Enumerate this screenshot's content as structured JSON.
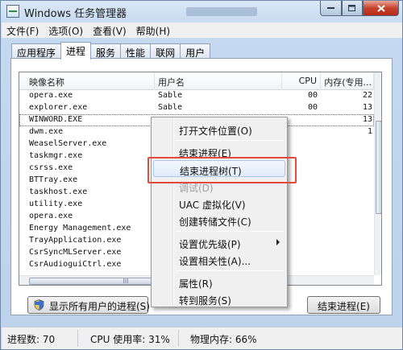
{
  "window": {
    "title": "Windows 任务管理器"
  },
  "menu": [
    "文件(F)",
    "选项(O)",
    "查看(V)",
    "帮助(H)"
  ],
  "tabs": [
    {
      "label": "应用程序",
      "active": false
    },
    {
      "label": "进程",
      "active": true
    },
    {
      "label": "服务",
      "active": false
    },
    {
      "label": "性能",
      "active": false
    },
    {
      "label": "联网",
      "active": false
    },
    {
      "label": "用户",
      "active": false
    }
  ],
  "process_list": {
    "columns": [
      "映像名称",
      "用户名",
      "CPU",
      "内存(专用..."
    ],
    "rows": [
      {
        "name": "opera.exe",
        "user": "Sable",
        "cpu": "00",
        "mem": "22"
      },
      {
        "name": "explorer.exe",
        "user": "Sable",
        "cpu": "00",
        "mem": "13"
      },
      {
        "name": "WINWORD.EXE",
        "user": "",
        "cpu": "",
        "mem": "13"
      },
      {
        "name": "dwm.exe",
        "user": "",
        "cpu": "",
        "mem": "1"
      },
      {
        "name": "WeaselServer.exe",
        "user": "",
        "cpu": "",
        "mem": ""
      },
      {
        "name": "taskmgr.exe",
        "user": "",
        "cpu": "",
        "mem": ""
      },
      {
        "name": "csrss.exe",
        "user": "",
        "cpu": "",
        "mem": ""
      },
      {
        "name": "BTTray.exe",
        "user": "",
        "cpu": "",
        "mem": ""
      },
      {
        "name": "taskhost.exe",
        "user": "",
        "cpu": "",
        "mem": ""
      },
      {
        "name": "utility.exe",
        "user": "",
        "cpu": "",
        "mem": ""
      },
      {
        "name": "opera.exe",
        "user": "",
        "cpu": "",
        "mem": ""
      },
      {
        "name": "Energy Management.exe",
        "user": "",
        "cpu": "",
        "mem": ""
      },
      {
        "name": "TrayApplication.exe",
        "user": "",
        "cpu": "",
        "mem": ""
      },
      {
        "name": "CsrSyncMLServer.exe",
        "user": "",
        "cpu": "",
        "mem": ""
      },
      {
        "name": "CsrAudioguiCtrl.exe",
        "user": "",
        "cpu": "",
        "mem": ""
      }
    ],
    "selected_row": 2,
    "scroll_grip": "III"
  },
  "buttons": {
    "show_all": "显示所有用户的进程(S)",
    "end_process": "结束进程(E)"
  },
  "status": {
    "process_count": "进程数: 70",
    "cpu_usage": "CPU 使用率: 31%",
    "memory": "物理内存: 66%"
  },
  "context_menu": {
    "items": [
      {
        "label": "打开文件位置(O)",
        "disabled": false,
        "submenu": false
      },
      {
        "label": "结束进程(E)",
        "disabled": false,
        "submenu": false
      },
      {
        "label": "结束进程树(T)",
        "disabled": false,
        "submenu": false,
        "hover": true
      },
      {
        "label": "调试(D)",
        "disabled": true,
        "submenu": false
      },
      {
        "label": "UAC 虚拟化(V)",
        "disabled": false,
        "submenu": false
      },
      {
        "label": "创建转储文件(C)",
        "disabled": false,
        "submenu": false
      },
      {
        "label": "设置优先级(P)",
        "disabled": false,
        "submenu": true
      },
      {
        "label": "设置相关性(A)...",
        "disabled": false,
        "submenu": false
      },
      {
        "label": "属性(R)",
        "disabled": false,
        "submenu": false
      },
      {
        "label": "转到服务(S)",
        "disabled": false,
        "submenu": false
      }
    ]
  },
  "colors": {
    "highlight_box": "#e24a3c",
    "close_button": "#c7432d"
  }
}
